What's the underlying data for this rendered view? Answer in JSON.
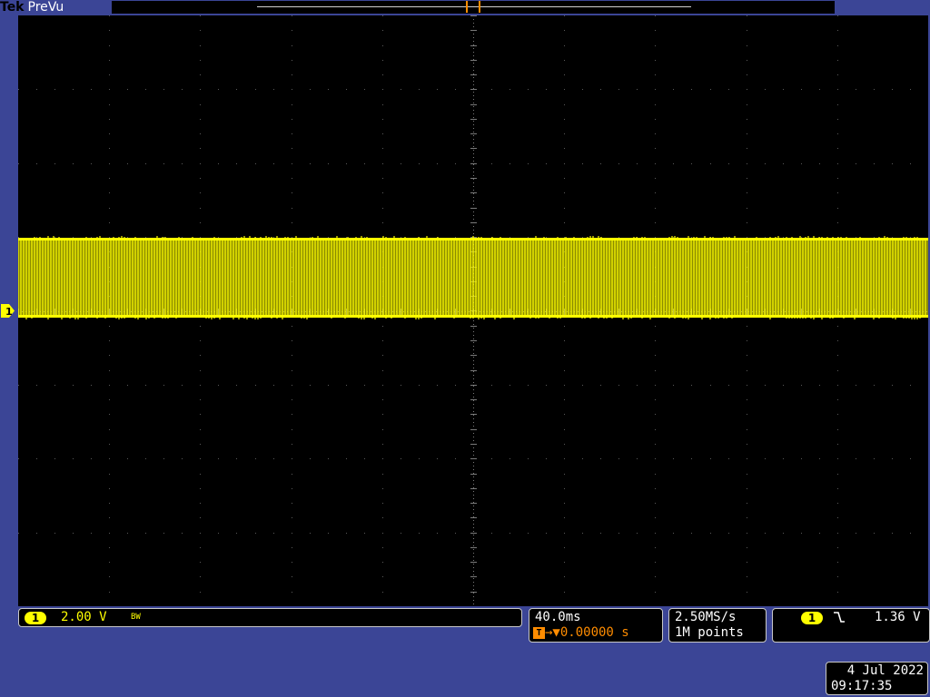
{
  "header": {
    "brand": "Tek",
    "mode": "PreVu"
  },
  "record_view": {
    "trigger_marker_label": "T"
  },
  "channel1": {
    "marker_label": "1",
    "badge": "1",
    "vertical_scale": "2.00 V",
    "bandwidth_limit": "BW",
    "trace_color": "#ffff00"
  },
  "timebase": {
    "horizontal_scale": "40.0ms",
    "trigger_icon": "T",
    "delay_arrow": "→▼",
    "delay": "0.00000 s"
  },
  "acquisition": {
    "sample_rate": "2.50MS/s",
    "record_length": "1M points"
  },
  "trigger": {
    "source_badge": "1",
    "slope_icon": "falling-edge-icon",
    "slope_glyph": "⌐",
    "level": "1.36 V"
  },
  "timestamp": {
    "date": "4 Jul  2022",
    "time": "09:17:35"
  },
  "colors": {
    "background": "#3b4596",
    "screen": "#000000",
    "trigger_orange": "#ff8c00",
    "channel1_yellow": "#ffff00"
  }
}
